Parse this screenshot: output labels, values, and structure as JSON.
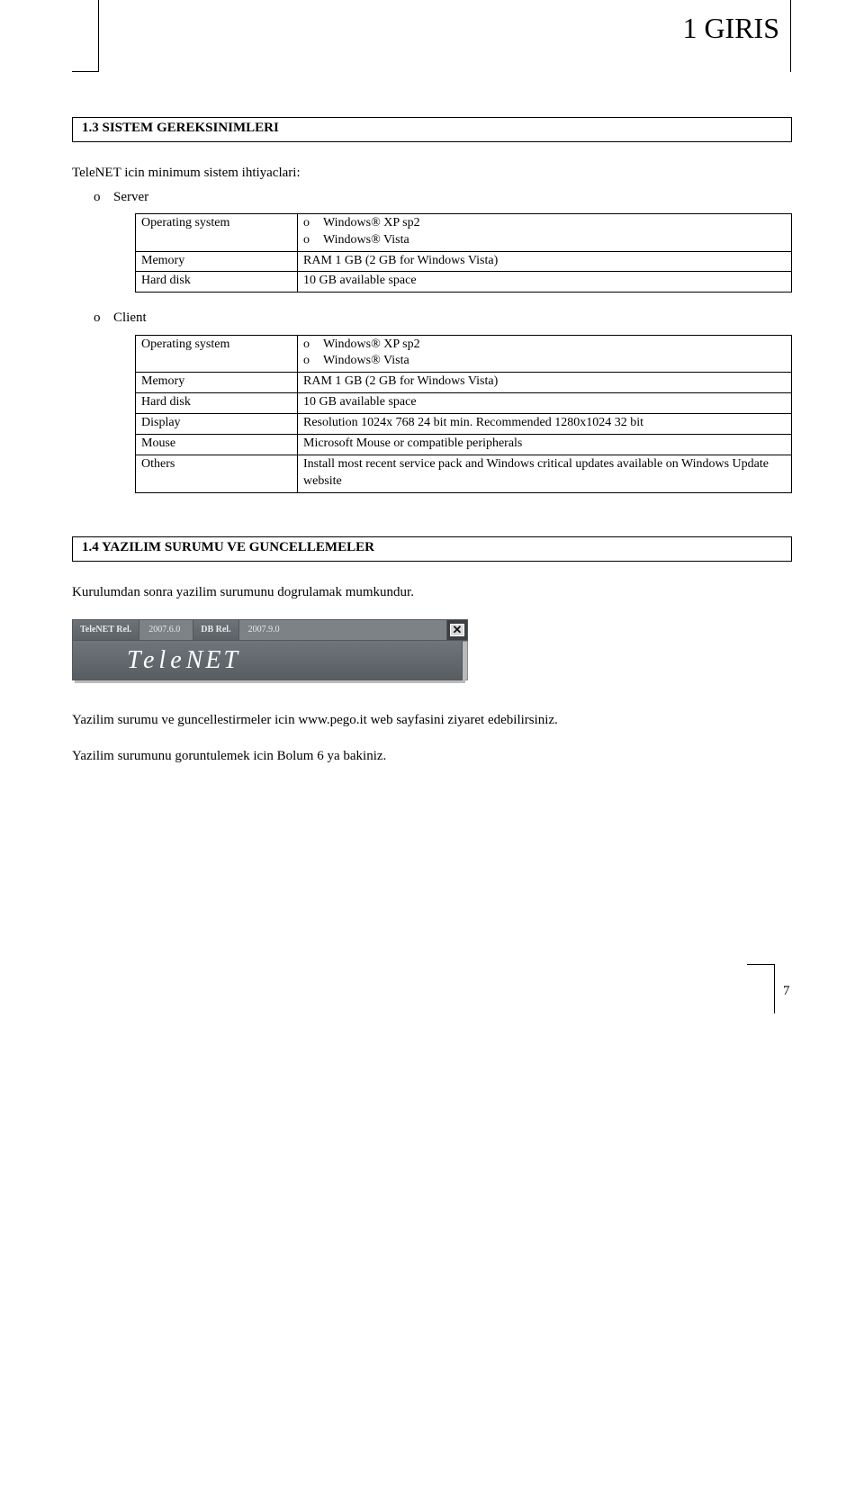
{
  "header": {
    "title": "1 GIRIS"
  },
  "section_1_3": {
    "heading": "1.3 SISTEM GEREKSINIMLERI",
    "intro": "TeleNET icin minimum sistem ihtiyaclari:",
    "server_label": "Server",
    "client_label": "Client",
    "marker": "o",
    "server_table": {
      "rows": [
        {
          "key": "Operating system",
          "values": [
            "Windows® XP sp2",
            "Windows® Vista"
          ],
          "bulleted": true
        },
        {
          "key": "Memory",
          "values": [
            "RAM 1 GB (2 GB for Windows Vista)"
          ],
          "bulleted": false
        },
        {
          "key": "Hard disk",
          "values": [
            "10 GB available space"
          ],
          "bulleted": false
        }
      ]
    },
    "client_table": {
      "rows": [
        {
          "key": "Operating system",
          "values": [
            "Windows® XP sp2",
            "Windows® Vista"
          ],
          "bulleted": true
        },
        {
          "key": "Memory",
          "values": [
            "RAM 1 GB (2 GB for Windows Vista)"
          ],
          "bulleted": false
        },
        {
          "key": "Hard disk",
          "values": [
            "10 GB available space"
          ],
          "bulleted": false
        },
        {
          "key": "Display",
          "values": [
            "Resolution 1024x 768 24 bit min. Recommended 1280x1024 32 bit"
          ],
          "bulleted": false
        },
        {
          "key": "Mouse",
          "values": [
            "Microsoft Mouse or compatible peripherals"
          ],
          "bulleted": false
        },
        {
          "key": "Others",
          "values": [
            "Install most recent service pack and Windows critical updates available on Windows Update website"
          ],
          "bulleted": false
        }
      ]
    }
  },
  "section_1_4": {
    "heading": "1.4 YAZILIM SURUMU VE GUNCELLEMELER",
    "p1": "Kurulumdan sonra yazilim surumunu dogrulamak mumkundur.",
    "toolbar": {
      "tele_label": "TeleNET Rel.",
      "tele_value": "2007.6.0",
      "db_label": "DB Rel.",
      "db_value": "2007.9.0",
      "close_glyph": "✕",
      "logo_tele": "Tele",
      "logo_net": "NET"
    },
    "p2": "Yazilim surumu ve guncellestirmeler icin www.pego.it web sayfasini ziyaret edebilirsiniz.",
    "p3": "Yazilim surumunu goruntulemek icin Bolum 6 ya bakiniz."
  },
  "footer": {
    "page": "7"
  }
}
